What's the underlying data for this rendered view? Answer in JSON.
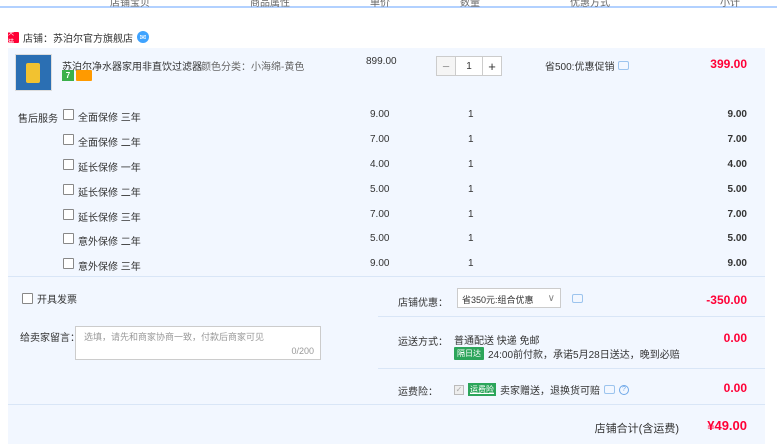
{
  "header": {
    "columns": [
      "店铺宝贝",
      "商品属性",
      "单价",
      "数量",
      "优惠方式",
      "小计"
    ]
  },
  "shop": {
    "badge_text": "天猫",
    "label": "店铺：苏泊尔官方旗舰店",
    "chat_icon": "wangwang-icon"
  },
  "product": {
    "title": "苏泊尔净水器家用非直饮过滤器...",
    "attr": "颜色分类：小海绵-黄色",
    "price": "899.00",
    "quantity": "1",
    "minus": "−",
    "plus": "+",
    "promo": "省500:优惠促销",
    "subtotal": "399.00",
    "badge7": "7"
  },
  "services": {
    "label": "售后服务",
    "items": [
      {
        "name": "全面保修 三年",
        "price": "9.00",
        "qty": "1",
        "subtotal": "9.00"
      },
      {
        "name": "全面保修 二年",
        "price": "7.00",
        "qty": "1",
        "subtotal": "7.00"
      },
      {
        "name": "延长保修 一年",
        "price": "4.00",
        "qty": "1",
        "subtotal": "4.00"
      },
      {
        "name": "延长保修 二年",
        "price": "5.00",
        "qty": "1",
        "subtotal": "5.00"
      },
      {
        "name": "延长保修 三年",
        "price": "7.00",
        "qty": "1",
        "subtotal": "7.00"
      },
      {
        "name": "意外保修 二年",
        "price": "5.00",
        "qty": "1",
        "subtotal": "5.00"
      },
      {
        "name": "意外保修 三年",
        "price": "9.00",
        "qty": "1",
        "subtotal": "9.00"
      }
    ]
  },
  "invoice": {
    "label": "开具发票"
  },
  "message": {
    "label": "给卖家留言：",
    "placeholder": "选填，请先和商家协商一致，付款后商家可见",
    "count": "0/200"
  },
  "discount": {
    "label": "店铺优惠：",
    "selected": "省350元:组合优惠",
    "amount": "-350.00"
  },
  "shipping": {
    "label": "运送方式：",
    "line1": "普通配送 快递 免邮",
    "badge": "隔日达",
    "line2": "24:00前付款，承诺5月28日送达，晚到必赔",
    "amount": "0.00"
  },
  "insurance": {
    "label": "运费险：",
    "badge": "运费险",
    "text": "卖家赠送，退换货可赔",
    "help": "?",
    "amount": "0.00"
  },
  "total": {
    "label": "店铺合计(含运费)",
    "value": "¥49.00"
  }
}
